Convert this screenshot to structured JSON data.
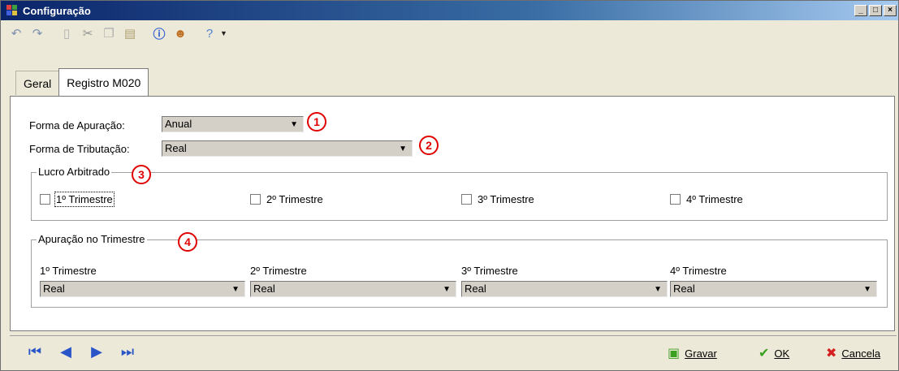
{
  "window": {
    "title": "Configuração",
    "controls": [
      "_",
      "□",
      "×"
    ]
  },
  "toolbar": {
    "icons": [
      "undo-icon",
      "redo-icon",
      "new-icon",
      "cut-icon",
      "copy-icon",
      "paste-icon",
      "info-icon",
      "user-icon",
      "help-icon"
    ]
  },
  "tabs": [
    {
      "label": "Geral",
      "active": false
    },
    {
      "label": "Registro M020",
      "active": true
    }
  ],
  "form": {
    "apuracao_label": "Forma de Apuração:",
    "apuracao_value": "Anual",
    "tributacao_label": "Forma de Tributação:",
    "tributacao_value": "Real"
  },
  "badges": [
    "1",
    "2",
    "3",
    "4"
  ],
  "lucro": {
    "title": "Lucro Arbitrado",
    "items": [
      "1º Trimestre",
      "2º Trimestre",
      "3º Trimestre",
      "4º Trimestre"
    ]
  },
  "apuracao_trimestre": {
    "title": "Apuração no Trimestre",
    "items": [
      {
        "label": "1º Trimestre",
        "value": "Real"
      },
      {
        "label": "2º Trimestre",
        "value": "Real"
      },
      {
        "label": "3º Trimestre",
        "value": "Real"
      },
      {
        "label": "4º Trimestre",
        "value": "Real"
      }
    ]
  },
  "bottom": {
    "gravar": "Gravar",
    "ok": "OK",
    "cancela": "Cancela"
  },
  "colors": {
    "accent_badge": "#e00000",
    "title_gradient_start": "#0a246a",
    "ok_green": "#3aa020",
    "cancel_red": "#d42020"
  }
}
